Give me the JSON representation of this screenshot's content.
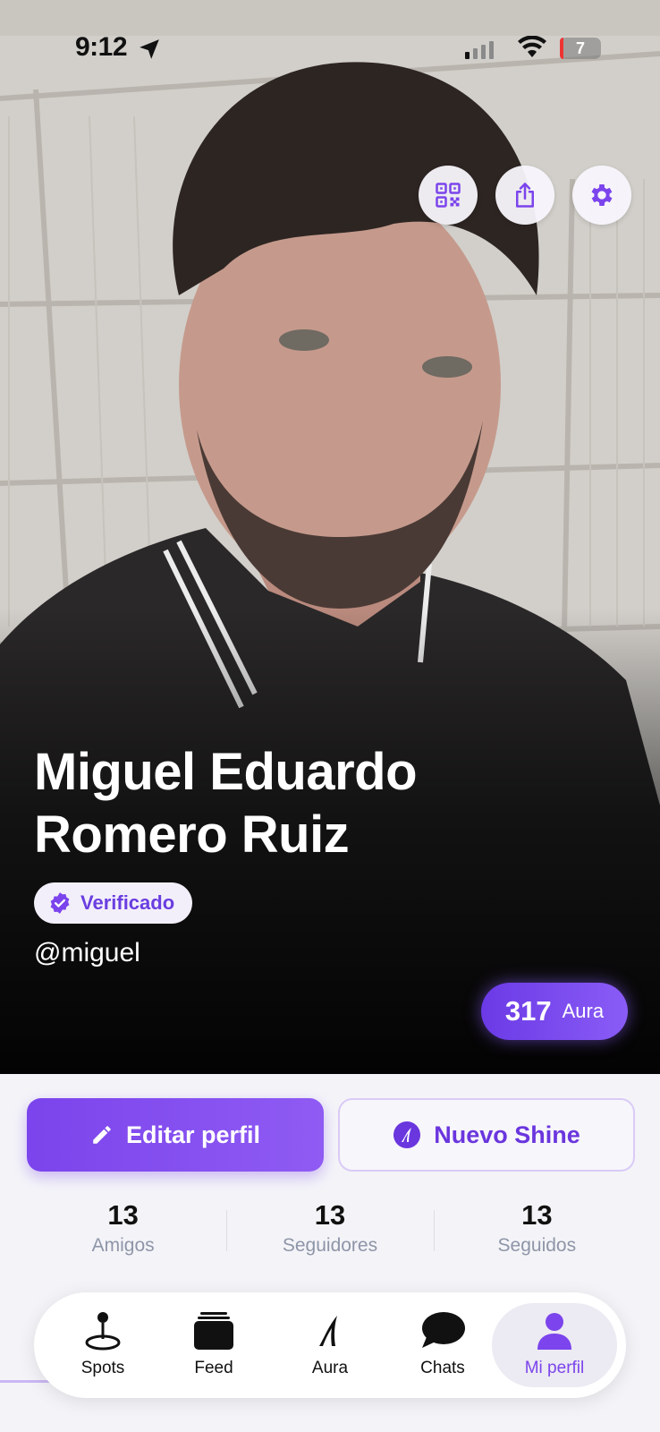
{
  "status_bar": {
    "time": "9:12",
    "battery": "7"
  },
  "profile": {
    "name_line1": "Miguel Eduardo",
    "name_line2": "Romero Ruiz",
    "verified_label": "Verificado",
    "username": "@miguel",
    "aura_value": "317",
    "aura_unit": "Aura"
  },
  "header_actions": [
    {
      "name": "qr-code",
      "icon": "qr-code-icon"
    },
    {
      "name": "share",
      "icon": "share-icon"
    },
    {
      "name": "settings",
      "icon": "gear-icon"
    }
  ],
  "actions": {
    "edit_label": "Editar perfil",
    "shine_label": "Nuevo Shine"
  },
  "stats": [
    {
      "value": "13",
      "label": "Amigos"
    },
    {
      "value": "13",
      "label": "Seguidores"
    },
    {
      "value": "13",
      "label": "Seguidos"
    }
  ],
  "tabs": [
    {
      "label": "Spots",
      "icon": "joystick-pin-icon",
      "active": false
    },
    {
      "label": "Feed",
      "icon": "stack-icon",
      "active": false
    },
    {
      "label": "Aura",
      "icon": "aura-flame-icon",
      "active": false
    },
    {
      "label": "Chats",
      "icon": "chat-bubble-icon",
      "active": false
    },
    {
      "label": "Mi perfil",
      "icon": "person-icon",
      "active": true
    }
  ],
  "colors": {
    "accent": "#7b44ec",
    "accent_light": "#8f5bf3",
    "muted_text": "#8e95a8"
  }
}
